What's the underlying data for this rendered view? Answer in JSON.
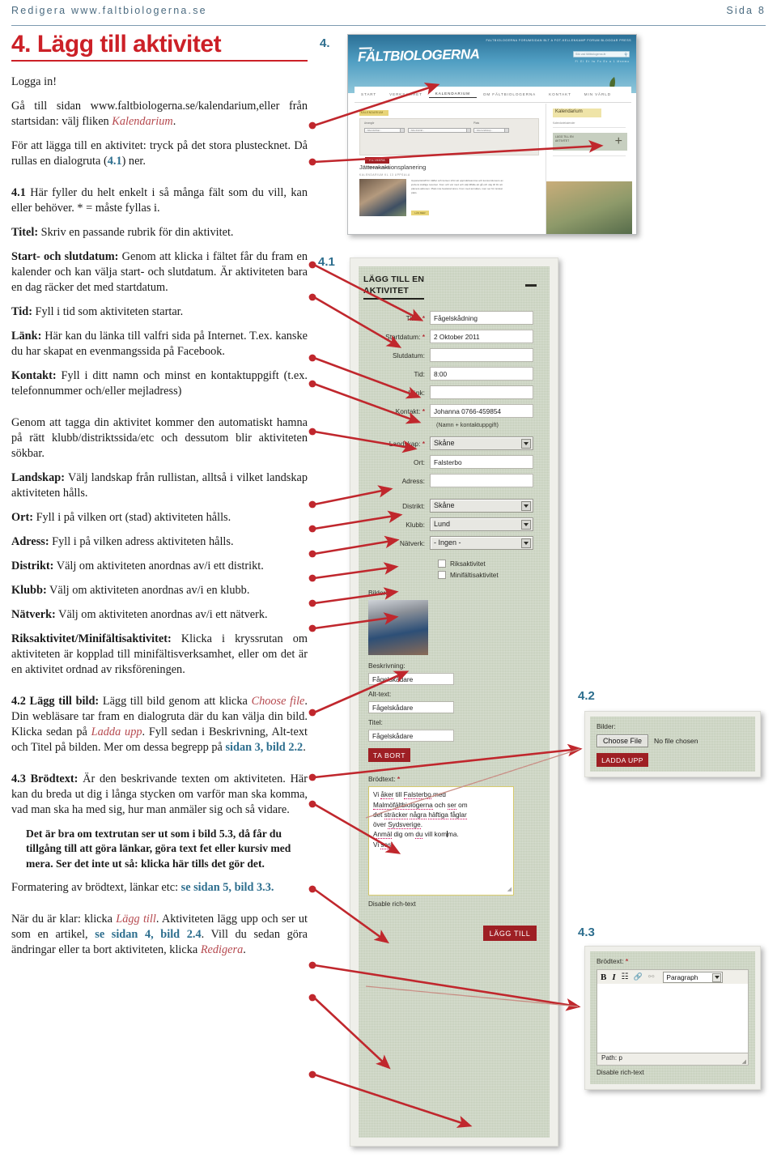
{
  "header": {
    "left": "Redigera www.faltbiologerna.se",
    "right": "Sida 8"
  },
  "doc": {
    "title": "4. Lägg till aktivitet",
    "p_login": "Logga in!",
    "p_goto_a": "Gå till sidan www.faltbiologerna.se/kalendarium,eller från startsidan: välj fliken ",
    "p_goto_link": "Kalendarium",
    "p_goto_b": ".",
    "p_add_a": "För att lägga till en aktivitet: tryck på det stora plustecknet. Då rullas en dialogruta (",
    "p_add_ref": "4.1",
    "p_add_b": ") ner.",
    "p_41_num": "4.1",
    "p_41_body": " Här fyller du helt enkelt i så många fält som du vill, kan eller behöver. * = måste fyllas i.",
    "titel_b": "Titel:",
    "titel_t": " Skriv en passande rubrik för din aktivitet.",
    "start_b": "Start- och slutdatum:",
    "start_t": " Genom att klicka i fältet får du fram en kalender och kan välja start- och slutdatum. Är aktiviteten bara en dag räcker det med startdatum.",
    "tid_b": "Tid:",
    "tid_t": " Fyll i tid som aktiviteten startar.",
    "lank_b": "Länk:",
    "lank_t": " Här kan du länka till valfri sida på Internet. T.ex. kanske du har skapat en evenmangssida på Facebook.",
    "kontakt_b": "Kontakt:",
    "kontakt_t": " Fyll i ditt namn och minst en kontaktuppgift (t.ex. telefonnummer och/eller mejladress)",
    "tagga": "Genom att tagga din aktivitet kommer den automatiskt hamna på rätt klubb/distriktssida/etc och dessutom blir aktiviteten sökbar.",
    "landskap_b": "Landskap:",
    "landskap_t": " Välj landskap från rullistan, alltså i vilket landskap aktiviteten hålls.",
    "ort_b": "Ort:",
    "ort_t": " Fyll i på vilken ort (stad) aktiviteten hålls.",
    "adress_b": "Adress:",
    "adress_t": " Fyll i på vilken adress aktiviteten hålls.",
    "distrikt_b": "Distrikt:",
    "distrikt_t": " Välj om aktiviteten anordnas av/i ett distrikt.",
    "klubb_b": "Klubb:",
    "klubb_t": " Välj om aktiviteten anordnas av/i en klubb.",
    "natverk_b": "Nätverk:",
    "natverk_t": " Välj om aktiviteten anordnas av/i ett nätverk.",
    "riks_b": "Riksaktivitet/Minifältisaktivitet:",
    "riks_t": " Klicka i kryssrutan om aktiviteten är kopplad till minifältisverksamhet, eller om det är en aktivitet ordnad av riksföreningen.",
    "p42_b": "4.2 Lägg till bild:",
    "p42_t1": " Lägg till bild genom att klicka ",
    "p42_em1": "Choose file",
    "p42_t2": ". Din webläsare tar fram en dialogruta där du kan välja din bild. Klicka sedan på ",
    "p42_em2": "Ladda upp",
    "p42_t3": ". Fyll sedan i Beskrivning, Alt-text och Titel på bilden. Mer om dessa begrepp på ",
    "p42_ref": "sidan 3, bild 2.2",
    "p42_t4": ".",
    "p43_b": "4.3 Brödtext:",
    "p43_t": " Är den beskrivande texten om aktiviteten. Här kan du breda ut dig i långa stycken om varför man ska komma, vad man ska ha med sig, hur man anmäler sig och så vidare.",
    "p43_indent": "Det är bra om textrutan ser ut som i bild 5.3, då får du tillgång till att göra länkar, göra text fet eller kursiv med mera. Ser det inte ut så: klicka här tills det gör det.",
    "p_form_a": "Formatering av brödtext, länkar etc: ",
    "p_form_ref": "se sidan 5, bild 3.3.",
    "p_klar_a": "När du är klar: klicka ",
    "p_klar_em1": "Lägg till",
    "p_klar_b": ". Aktiviteten lägg upp och ser ut som en artikel, ",
    "p_klar_ref": "se sidan 4, bild 2.4",
    "p_klar_c": ". Vill du sedan göra ändringar eller ta bort aktiviteten, klicka ",
    "p_klar_em2": "Redigera",
    "p_klar_d": "."
  },
  "fignums": {
    "f4": "4.",
    "f41": "4.1",
    "f42": "4.2",
    "f43": "4.3"
  },
  "website": {
    "topnav": "FALTBIOLOGERNA    FORUMSIDAN  BLT A    FOT-KELLENKAMP    FORUM    BLOGGAR    PRESS",
    "logo": "FÄLTBIOLOGERNA",
    "search_placeholder": "Sök vad fältbiologerna är",
    "langs": "Fl    El    Et    Iw    Fo    Ex    a    1   Mnemo",
    "tabs": [
      "START",
      "VERKSAMHET",
      "KALENDARIUM",
      "OM FÄLTBIOLOGERNA",
      "KONTAKT",
      "MIN VÄRLD"
    ],
    "active_tab": "KALENDARIUM",
    "badge": "KALENDARIUM",
    "filter_label_left": "Arrangör",
    "filter_label_right": "Plats",
    "filter_sel1": "- Alla klubbar -",
    "filter_sel2": "- Alla distrikt -",
    "filter_sel3": "- Alla landskap -",
    "filter_button": "FILTRERA",
    "filter_spara": "Spara min sökning",
    "article_title": "Jätterakaktionsplanering",
    "article_meta": "KALENDARIUM          KL 13          UPPSALA",
    "article_body": "Uppstartsträff för träffar och kursen inför att uppmärksamma och konsumtionens av jordens ändliga resurser. Kom och var med och välj tillfälle att gå och väg till för att planera aktionen. Plats inte bestämd ännu. Kom med anmälan, men ser för önskat plats.",
    "article_more": "LÄS MER",
    "sidebar_title": "Kalendarium",
    "sidebar_sub": "Kalendariekalender",
    "add_label": "LÄGG TILL EN\nAKTIVITET",
    "add_plus": "+"
  },
  "form41": {
    "heading": "LÄGG TILL EN AKTIVITET",
    "fields": [
      {
        "label": "Titel:",
        "required": true,
        "value": "Fågelskådning",
        "type": "text"
      },
      {
        "label": "Startdatum:",
        "required": true,
        "value": "2 Oktober 2011",
        "type": "text"
      },
      {
        "label": "Slutdatum:",
        "required": false,
        "value": "",
        "type": "text"
      },
      {
        "label": "Tid:",
        "required": false,
        "value": "8:00",
        "type": "text"
      },
      {
        "label": "Länk:",
        "required": false,
        "value": "",
        "type": "text"
      },
      {
        "label": "Kontakt:",
        "required": true,
        "value": "Johanna 0766-459854",
        "type": "text"
      }
    ],
    "kontakt_hint": "(Namn + kontaktuppgift)",
    "fields2": [
      {
        "label": "Landskap:",
        "required": true,
        "value": "Skåne",
        "type": "select"
      },
      {
        "label": "Ort:",
        "required": false,
        "value": "Falsterbo",
        "type": "text"
      },
      {
        "label": "Adress:",
        "required": false,
        "value": "",
        "type": "text"
      },
      {
        "label": "Distrikt:",
        "required": false,
        "value": "Skåne",
        "type": "select"
      },
      {
        "label": "Klubb:",
        "required": false,
        "value": "Lund",
        "type": "select"
      },
      {
        "label": "Nätverk:",
        "required": false,
        "value": "- Ingen -",
        "type": "select"
      }
    ],
    "checkboxes": [
      {
        "label": "Riksaktivitet",
        "checked": false
      },
      {
        "label": "Minifältisaktivitet",
        "checked": false
      }
    ],
    "bilder_label": "Bilder:",
    "beskrivning_label": "Beskrivning:",
    "beskrivning_value": "Fågelskådare",
    "alttext_label": "Alt-text:",
    "alttext_value": "Fågelskådare",
    "titel_label": "Titel:",
    "titel_value": "Fågelskådare",
    "ta_bort": "TA BORT",
    "brodtext_label": "Brödtext:",
    "brodtext_line1": "Vi åker till Falsterbo med",
    "brodtext_line2": "Malmöfältbiologerna och ser om",
    "brodtext_line3": "det sträcker några häftiga fåglar",
    "brodtext_line4": "över Sydsverige.",
    "brodtext_line5": "Anmäl dig om du vill komma.",
    "brodtext_line6": "Vi ses!",
    "disable_rich": "Disable rich-text",
    "lagg_till": "LÄGG TILL"
  },
  "form42": {
    "bilder_label": "Bilder:",
    "choose_file": "Choose File",
    "no_file": "No file chosen",
    "ladda_upp": "LADDA UPP"
  },
  "form43": {
    "brodtext_label": "Brödtext:",
    "toolbar": {
      "bold": "B",
      "italic": "I",
      "list": "☰",
      "link": "🔗",
      "unlink": "⛓",
      "format": "Paragraph"
    },
    "path": "Path: p",
    "disable_rich": "Disable rich-text"
  },
  "colors": {
    "title_red": "#cc2027",
    "fig_blue": "#2d6e8e",
    "arrow_red": "#c0272d",
    "form_green": "#c3cdb8",
    "button_red": "#9e1f24",
    "header_blue": "#4b6b80"
  }
}
